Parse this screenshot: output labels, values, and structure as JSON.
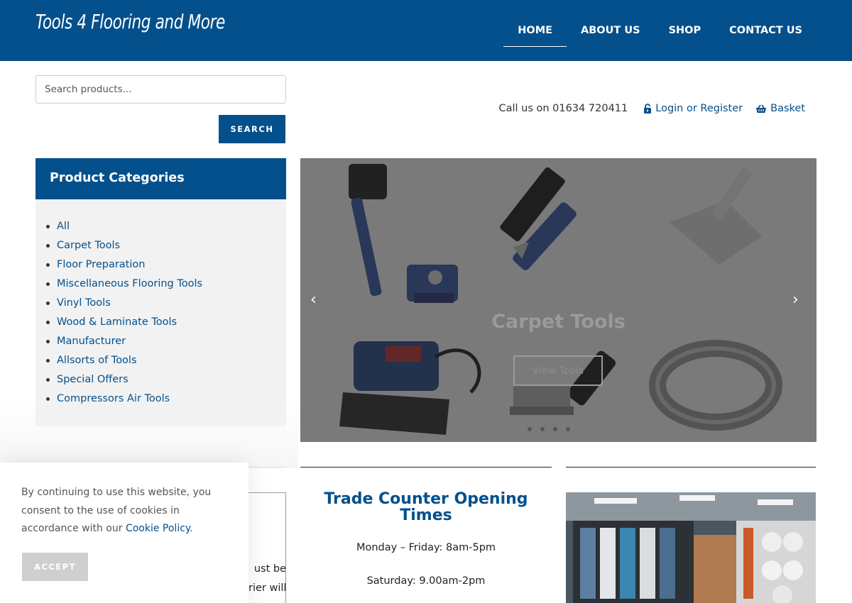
{
  "header": {
    "brand": "Tools 4 Flooring and More",
    "nav": [
      {
        "label": "HOME",
        "active": true
      },
      {
        "label": "ABOUT US",
        "active": false
      },
      {
        "label": "SHOP",
        "active": false
      },
      {
        "label": "CONTACT US",
        "active": false
      }
    ]
  },
  "search": {
    "placeholder": "Search products...",
    "button_label": "SEARCH"
  },
  "topbar": {
    "call": "Call us on 01634 720411",
    "login": "Login or Register",
    "basket": "Basket"
  },
  "categories": {
    "title": "Product Categories",
    "items": [
      "All",
      "Carpet Tools",
      "Floor Preparation",
      "Miscellaneous Flooring Tools",
      "Vinyl Tools",
      "Wood & Laminate Tools",
      "Manufacturer",
      "Allsorts of Tools",
      "Special Offers",
      "Compressors Air Tools"
    ]
  },
  "slider": {
    "title": "Carpet Tools",
    "button_label": "View Tools",
    "prev_glyph": "‹",
    "next_glyph": "›",
    "slides": 4,
    "active_slide": 1
  },
  "hours": {
    "title": "Trade Counter Opening Times",
    "weekday": "Monday – Friday: 8am-5pm",
    "saturday": "Saturday: 9.00am-2pm"
  },
  "left_fragments": [
    "ust be",
    "rier will"
  ],
  "cookie": {
    "text": "By continuing to use this website, you consent to the use of cookies in accordance with our ",
    "link": "Cookie Policy",
    "suffix": ".",
    "accept_label": "ACCEPT"
  },
  "colors": {
    "brand_blue": "#03508c",
    "category_bg": "#f2f2f2",
    "accept_gray": "#cfcfcf"
  }
}
